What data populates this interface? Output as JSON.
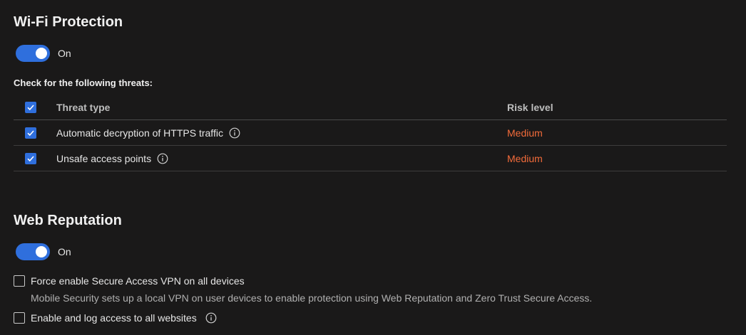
{
  "wifi": {
    "title": "Wi-Fi Protection",
    "toggle_label": "On",
    "subheading": "Check for the following threats:",
    "columns": {
      "type": "Threat type",
      "risk": "Risk level"
    },
    "rows": [
      {
        "name": "Automatic decryption of HTTPS traffic",
        "risk": "Medium",
        "checked": true
      },
      {
        "name": "Unsafe access points",
        "risk": "Medium",
        "checked": true
      }
    ]
  },
  "web": {
    "title": "Web Reputation",
    "toggle_label": "On",
    "options": [
      {
        "label": "Force enable Secure Access VPN on all devices",
        "description": "Mobile Security sets up a local VPN on user devices to enable protection using Web Reputation and Zero Trust Secure Access.",
        "checked": false
      },
      {
        "label": "Enable and log access to all websites",
        "checked": false
      }
    ]
  },
  "colors": {
    "accent": "#2f6fdd",
    "risk_medium": "#f26b3a",
    "background": "#1a1919"
  },
  "icons": [
    "check-icon",
    "info-icon"
  ]
}
